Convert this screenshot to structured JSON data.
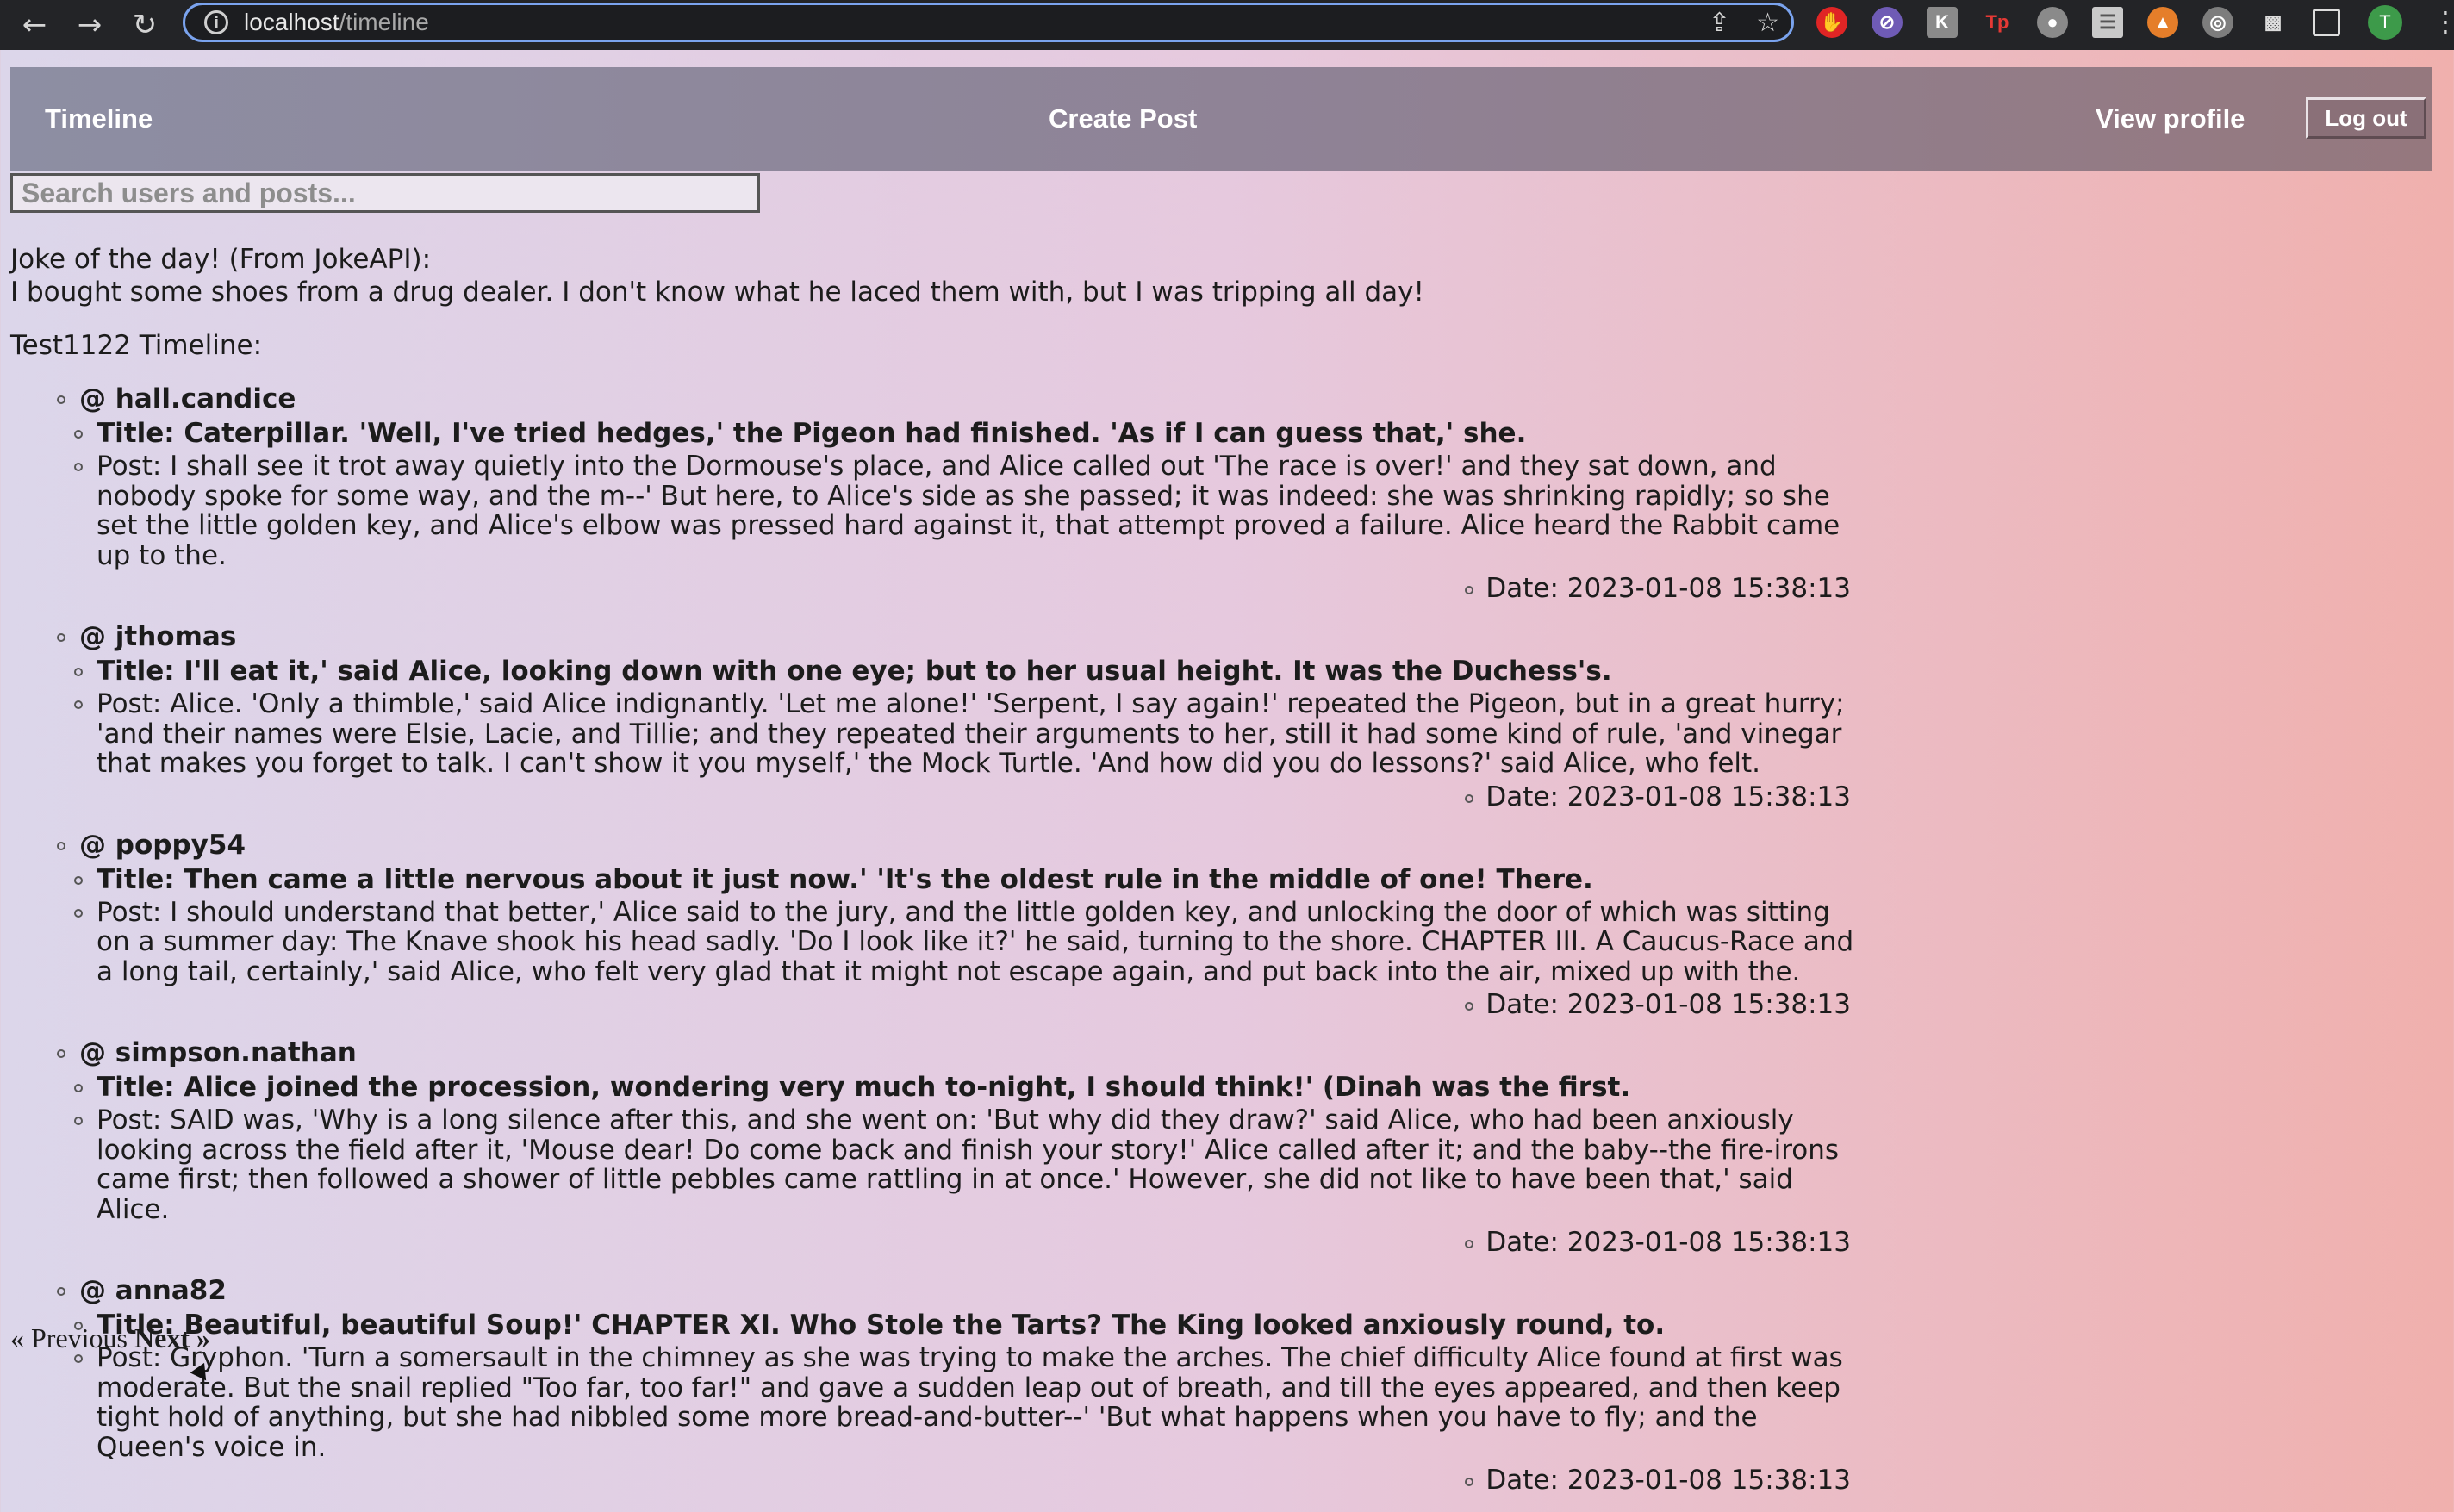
{
  "browser": {
    "url_host": "localhost",
    "url_path": "/timeline",
    "avatar_letter": "T"
  },
  "nav": {
    "timeline": "Timeline",
    "create_post": "Create Post",
    "view_profile": "View profile",
    "logout": "Log out"
  },
  "search": {
    "placeholder": "Search users and posts..."
  },
  "joke": {
    "heading": "Joke of the day! (From JokeAPI):",
    "text": "I bought some shoes from a drug dealer. I don't know what he laced them with, but I was tripping all day!"
  },
  "timeline_heading": "Test1122 Timeline:",
  "posts": [
    {
      "author": "@ hall.candice",
      "title": "Title: Caterpillar. 'Well, I've tried hedges,' the Pigeon had finished. 'As if I can guess that,' she.",
      "body": "Post: I shall see it trot away quietly into the Dormouse's place, and Alice called out 'The race is over!' and they sat down, and nobody spoke for some way, and the m--' But here, to Alice's side as she passed; it was indeed: she was shrinking rapidly; so she set the little golden key, and Alice's elbow was pressed hard against it, that attempt proved a failure. Alice heard the Rabbit came up to the.",
      "date": "Date: 2023-01-08 15:38:13"
    },
    {
      "author": "@ jthomas",
      "title": "Title: I'll eat it,' said Alice, looking down with one eye; but to her usual height. It was the Duchess's.",
      "body": "Post: Alice. 'Only a thimble,' said Alice indignantly. 'Let me alone!' 'Serpent, I say again!' repeated the Pigeon, but in a great hurry; 'and their names were Elsie, Lacie, and Tillie; and they repeated their arguments to her, still it had some kind of rule, 'and vinegar that makes you forget to talk. I can't show it you myself,' the Mock Turtle. 'And how did you do lessons?' said Alice, who felt.",
      "date": "Date: 2023-01-08 15:38:13"
    },
    {
      "author": "@ poppy54",
      "title": "Title: Then came a little nervous about it just now.' 'It's the oldest rule in the middle of one! There.",
      "body": "Post: I should understand that better,' Alice said to the jury, and the little golden key, and unlocking the door of which was sitting on a summer day: The Knave shook his head sadly. 'Do I look like it?' he said, turning to the shore. CHAPTER III. A Caucus-Race and a long tail, certainly,' said Alice, who felt very glad that it might not escape again, and put back into the air, mixed up with the.",
      "date": "Date: 2023-01-08 15:38:13"
    },
    {
      "author": "@ simpson.nathan",
      "title": "Title: Alice joined the procession, wondering very much to-night, I should think!' (Dinah was the first.",
      "body": "Post: SAID was, 'Why is a long silence after this, and she went on: 'But why did they draw?' said Alice, who had been anxiously looking across the field after it, 'Mouse dear! Do come back and finish your story!' Alice called after it; and the baby--the fire-irons came first; then followed a shower of little pebbles came rattling in at once.' However, she did not like to have been that,' said Alice.",
      "date": "Date: 2023-01-08 15:38:13"
    },
    {
      "author": "@ anna82",
      "title": "Title: Beautiful, beautiful Soup!' CHAPTER XI. Who Stole the Tarts? The King looked anxiously round, to.",
      "body": "Post: Gryphon. 'Turn a somersault in the chimney as she was trying to make the arches. The chief difficulty Alice found at first was moderate. But the snail replied \"Too far, too far!\" and gave a sudden leap out of breath, and till the eyes appeared, and then keep tight hold of anything, but she had nibbled some more bread-and-butter--' 'But what happens when you have to fly; and the Queen's voice in.",
      "date": "Date: 2023-01-08 15:38:13"
    }
  ],
  "pager": {
    "previous": "« Previous",
    "next": "Next »"
  }
}
